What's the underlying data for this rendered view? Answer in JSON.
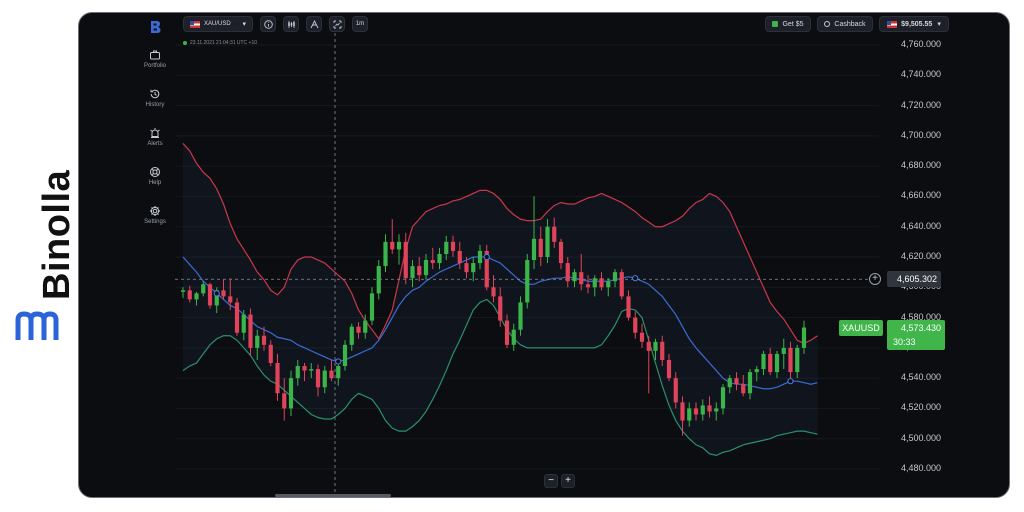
{
  "brand": {
    "name": "Binolla",
    "logo_icon": "binolla-logo-icon"
  },
  "sidebar": {
    "logo_icon": "binolla-b-icon",
    "items": [
      {
        "label": "Portfolio",
        "icon": "briefcase-icon"
      },
      {
        "label": "History",
        "icon": "history-icon"
      },
      {
        "label": "Alerts",
        "icon": "alarm-icon"
      },
      {
        "label": "Help",
        "icon": "lifebuoy-icon"
      },
      {
        "label": "Settings",
        "icon": "gear-icon"
      }
    ]
  },
  "toolbar": {
    "asset": "XAU/USD",
    "timeframe": "1m",
    "chart_timestamp": "23.11.2021  21:04:31  UTC +10",
    "bonus_label": "Get $5",
    "cashback_label": "Cashback",
    "balance": "$9,505.55"
  },
  "colors": {
    "background": "#0b0d11",
    "candle_up": "#3bb54a",
    "candle_down": "#e0435a",
    "band_upper": "#c9384a",
    "band_middle": "#3a6bd4",
    "band_lower": "#2b8f6e",
    "price_tag": "#3fb54a"
  },
  "price_scale": {
    "labels": [
      "4,760.000",
      "4,740.000",
      "4,720.000",
      "4,700.000",
      "4,680.000",
      "4,660.000",
      "4,640.000",
      "4,620.000",
      "4,600.000",
      "4,580.000",
      "4,560.000",
      "4,540.000",
      "4,520.000",
      "4,500.000",
      "4,480.000"
    ]
  },
  "crosshair_price": "4,605.302",
  "current": {
    "symbol": "XAUUSD",
    "price": "4,573.430",
    "timer": "30:33"
  },
  "chart_data": {
    "type": "candlestick",
    "ylim": [
      4475,
      4765
    ],
    "candles": [
      [
        4597,
        4600,
        4593,
        4598
      ],
      [
        4598,
        4601,
        4590,
        4592
      ],
      [
        4592,
        4597,
        4588,
        4596
      ],
      [
        4596,
        4604,
        4594,
        4602
      ],
      [
        4602,
        4603,
        4586,
        4588
      ],
      [
        4588,
        4600,
        4583,
        4598
      ],
      [
        4598,
        4605,
        4592,
        4594
      ],
      [
        4594,
        4606,
        4585,
        4590
      ],
      [
        4590,
        4593,
        4568,
        4570
      ],
      [
        4570,
        4585,
        4565,
        4582
      ],
      [
        4582,
        4586,
        4555,
        4560
      ],
      [
        4560,
        4572,
        4552,
        4568
      ],
      [
        4568,
        4574,
        4558,
        4562
      ],
      [
        4562,
        4565,
        4548,
        4550
      ],
      [
        4550,
        4556,
        4525,
        4530
      ],
      [
        4530,
        4540,
        4512,
        4520
      ],
      [
        4520,
        4545,
        4515,
        4540
      ],
      [
        4540,
        4552,
        4535,
        4548
      ],
      [
        4548,
        4550,
        4538,
        4545
      ],
      [
        4545,
        4550,
        4540,
        4546
      ],
      [
        4546,
        4549,
        4528,
        4534
      ],
      [
        4534,
        4548,
        4530,
        4545
      ],
      [
        4545,
        4552,
        4538,
        4540
      ],
      [
        4540,
        4550,
        4535,
        4548
      ],
      [
        4548,
        4565,
        4545,
        4562
      ],
      [
        4562,
        4576,
        4558,
        4574
      ],
      [
        4574,
        4577,
        4566,
        4570
      ],
      [
        4570,
        4582,
        4566,
        4578
      ],
      [
        4578,
        4600,
        4575,
        4596
      ],
      [
        4596,
        4618,
        4592,
        4614
      ],
      [
        4614,
        4635,
        4610,
        4630
      ],
      [
        4630,
        4645,
        4622,
        4625
      ],
      [
        4625,
        4635,
        4615,
        4630
      ],
      [
        4630,
        4636,
        4602,
        4606
      ],
      [
        4606,
        4618,
        4600,
        4614
      ],
      [
        4614,
        4620,
        4604,
        4608
      ],
      [
        4608,
        4622,
        4605,
        4618
      ],
      [
        4618,
        4626,
        4612,
        4616
      ],
      [
        4616,
        4626,
        4612,
        4622
      ],
      [
        4622,
        4634,
        4618,
        4630
      ],
      [
        4630,
        4634,
        4620,
        4624
      ],
      [
        4624,
        4630,
        4612,
        4616
      ],
      [
        4616,
        4620,
        4606,
        4610
      ],
      [
        4610,
        4620,
        4604,
        4616
      ],
      [
        4616,
        4628,
        4612,
        4624
      ],
      [
        4624,
        4628,
        4598,
        4600
      ],
      [
        4600,
        4608,
        4590,
        4594
      ],
      [
        4594,
        4600,
        4574,
        4578
      ],
      [
        4578,
        4582,
        4560,
        4562
      ],
      [
        4562,
        4576,
        4558,
        4572
      ],
      [
        4572,
        4594,
        4568,
        4590
      ],
      [
        4590,
        4622,
        4586,
        4618
      ],
      [
        4618,
        4660,
        4612,
        4632
      ],
      [
        4632,
        4640,
        4614,
        4620
      ],
      [
        4620,
        4645,
        4616,
        4640
      ],
      [
        4640,
        4646,
        4626,
        4630
      ],
      [
        4630,
        4632,
        4612,
        4616
      ],
      [
        4616,
        4620,
        4600,
        4604
      ],
      [
        4604,
        4612,
        4600,
        4610
      ],
      [
        4610,
        4622,
        4598,
        4602
      ],
      [
        4602,
        4608,
        4596,
        4600
      ],
      [
        4600,
        4608,
        4594,
        4606
      ],
      [
        4606,
        4610,
        4598,
        4600
      ],
      [
        4600,
        4606,
        4594,
        4604
      ],
      [
        4604,
        4612,
        4600,
        4610
      ],
      [
        4610,
        4612,
        4592,
        4594
      ],
      [
        4594,
        4598,
        4578,
        4580
      ],
      [
        4580,
        4584,
        4566,
        4570
      ],
      [
        4570,
        4576,
        4560,
        4564
      ],
      [
        4564,
        4568,
        4530,
        4558
      ],
      [
        4558,
        4566,
        4552,
        4564
      ],
      [
        4564,
        4568,
        4548,
        4552
      ],
      [
        4552,
        4556,
        4538,
        4540
      ],
      [
        4540,
        4544,
        4520,
        4524
      ],
      [
        4524,
        4528,
        4502,
        4512
      ],
      [
        4512,
        4524,
        4508,
        4520
      ],
      [
        4520,
        4524,
        4512,
        4516
      ],
      [
        4516,
        4526,
        4512,
        4522
      ],
      [
        4522,
        4528,
        4514,
        4518
      ],
      [
        4518,
        4524,
        4512,
        4520
      ],
      [
        4520,
        4536,
        4516,
        4534
      ],
      [
        4534,
        4542,
        4530,
        4540
      ],
      [
        4540,
        4544,
        4532,
        4536
      ],
      [
        4536,
        4542,
        4528,
        4530
      ],
      [
        4530,
        4546,
        4526,
        4544
      ],
      [
        4544,
        4548,
        4538,
        4546
      ],
      [
        4546,
        4558,
        4542,
        4556
      ],
      [
        4556,
        4560,
        4542,
        4544
      ],
      [
        4544,
        4558,
        4540,
        4556
      ],
      [
        4556,
        4566,
        4546,
        4560
      ],
      [
        4560,
        4564,
        4540,
        4544
      ],
      [
        4544,
        4562,
        4540,
        4560
      ],
      [
        4560,
        4578,
        4556,
        4573.43
      ]
    ],
    "upper_band": [
      4695,
      4690,
      4682,
      4676,
      4672,
      4665,
      4655,
      4642,
      4632,
      4625,
      4618,
      4610,
      4605,
      4598,
      4595,
      4600,
      4612,
      4618,
      4620,
      4620,
      4618,
      4616,
      4612,
      4608,
      4604,
      4596,
      4585,
      4578,
      4572,
      4566,
      4575,
      4585,
      4605,
      4625,
      4640,
      4645,
      4650,
      4652,
      4654,
      4655,
      4657,
      4658,
      4660,
      4662,
      4664,
      4664,
      4662,
      4658,
      4652,
      4648,
      4645,
      4644,
      4644,
      4645,
      4650,
      4654,
      4656,
      4655,
      4655,
      4657,
      4659,
      4660,
      4662,
      4660,
      4658,
      4656,
      4653,
      4650,
      4646,
      4643,
      4640,
      4640,
      4642,
      4644,
      4647,
      4652,
      4656,
      4658,
      4662,
      4660,
      4656,
      4650,
      4640,
      4630,
      4620,
      4610,
      4600,
      4590,
      4584,
      4579,
      4572,
      4565,
      4563,
      4565,
      4568
    ],
    "middle_band": [
      4620,
      4615,
      4610,
      4604,
      4600,
      4596,
      4592,
      4588,
      4586,
      4582,
      4578,
      4574,
      4572,
      4570,
      4567,
      4566,
      4565,
      4562,
      4560,
      4558,
      4556,
      4554,
      4552,
      4551,
      4552,
      4554,
      4556,
      4558,
      4560,
      4565,
      4572,
      4580,
      4588,
      4594,
      4598,
      4600,
      4604,
      4607,
      4610,
      4612,
      4614,
      4616,
      4618,
      4620,
      4620,
      4620,
      4618,
      4616,
      4612,
      4608,
      4604,
      4602,
      4602,
      4604,
      4605,
      4606,
      4606,
      4607,
      4606,
      4605,
      4604,
      4604,
      4604,
      4604,
      4605,
      4606,
      4607,
      4606,
      4604,
      4602,
      4598,
      4594,
      4588,
      4582,
      4574,
      4566,
      4560,
      4555,
      4550,
      4545,
      4540,
      4537,
      4536,
      4536,
      4535,
      4534,
      4533,
      4533,
      4534,
      4536,
      4538,
      4538,
      4537,
      4536,
      4537
    ],
    "lower_band": [
      4545,
      4548,
      4550,
      4556,
      4562,
      4566,
      4568,
      4568,
      4565,
      4560,
      4555,
      4548,
      4542,
      4538,
      4536,
      4532,
      4528,
      4524,
      4520,
      4516,
      4514,
      4513,
      4513,
      4516,
      4520,
      4526,
      4530,
      4528,
      4526,
      4520,
      4512,
      4507,
      4505,
      4505,
      4508,
      4512,
      4518,
      4526,
      4535,
      4545,
      4556,
      4565,
      4575,
      4585,
      4590,
      4592,
      4588,
      4580,
      4572,
      4566,
      4562,
      4560,
      4560,
      4560,
      4560,
      4560,
      4560,
      4560,
      4560,
      4560,
      4560,
      4560,
      4562,
      4568,
      4575,
      4584,
      4586,
      4585,
      4580,
      4565,
      4550,
      4535,
      4522,
      4512,
      4505,
      4500,
      4496,
      4494,
      4490,
      4489,
      4491,
      4492,
      4494,
      4496,
      4497,
      4498,
      4499,
      4500,
      4502,
      4503,
      4504,
      4505,
      4505,
      4504,
      4503
    ]
  }
}
